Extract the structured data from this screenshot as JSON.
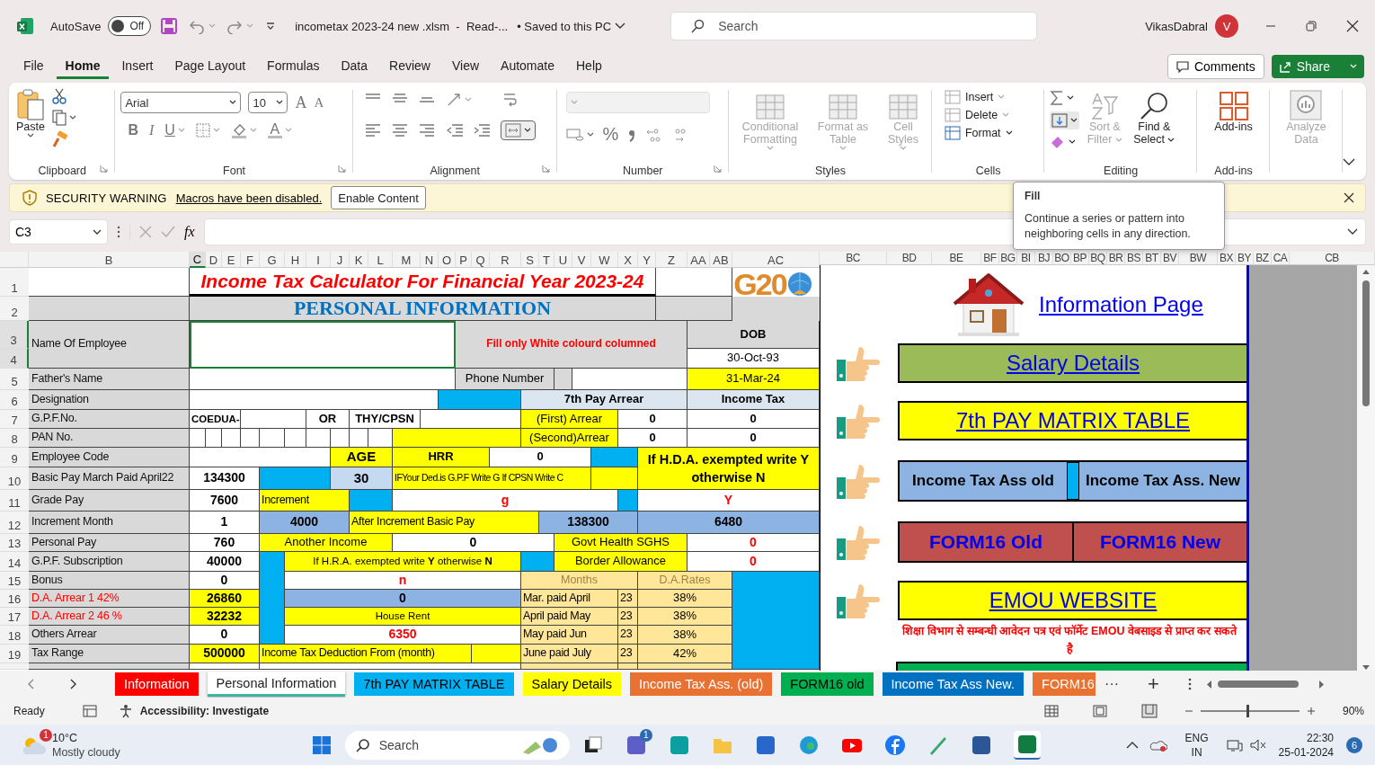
{
  "title_bar": {
    "autosave_label": "AutoSave",
    "autosave_toggle": {
      "label": "Off",
      "on": false
    },
    "file_name": "incometax 2023-24 new .xlsm  -  Read-...",
    "save_status": "• Saved to this PC",
    "search": {
      "placeholder": "Search"
    },
    "user_name": "VikasDabral",
    "avatar_letter": "V"
  },
  "menu_tabs": [
    {
      "label": "File",
      "selected": false
    },
    {
      "label": "Home",
      "selected": true
    },
    {
      "label": "Insert",
      "selected": false
    },
    {
      "label": "Page Layout",
      "selected": false
    },
    {
      "label": "Formulas",
      "selected": false
    },
    {
      "label": "Data",
      "selected": false
    },
    {
      "label": "Review",
      "selected": false
    },
    {
      "label": "View",
      "selected": false
    },
    {
      "label": "Automate",
      "selected": false
    },
    {
      "label": "Help",
      "selected": false
    }
  ],
  "header_buttons": {
    "comments": "Comments",
    "share": "Share"
  },
  "ribbon": {
    "groups": [
      "Clipboard",
      "Font",
      "Alignment",
      "Number",
      "Styles",
      "Cells",
      "Editing",
      "Add-ins"
    ],
    "paste": "Paste",
    "font_name": "Arial",
    "font_size": "10",
    "font_glyphs": [
      "A",
      "A"
    ],
    "format_glyphs": [
      "B",
      "I",
      "U"
    ],
    "font_color_glyph": "A",
    "percent_glyph": "%",
    "style_buttons": [
      {
        "label": "Conditional Formatting",
        "disabled": true
      },
      {
        "label": "Format as Table",
        "disabled": true
      },
      {
        "label": "Cell Styles",
        "disabled": true
      }
    ],
    "cell_buttons": [
      {
        "label": "Insert",
        "disabled": true
      },
      {
        "label": "Delete",
        "disabled": true
      },
      {
        "label": "Format",
        "disabled": false
      }
    ],
    "editing_buttons": [
      {
        "label": "Sort & Filter",
        "disabled": true
      },
      {
        "label": "Find & Select",
        "disabled": false
      }
    ],
    "addins_button": "Add-ins",
    "analyze_button": {
      "label": "Analyze Data",
      "disabled": true
    }
  },
  "security_bar": {
    "title": "SECURITY WARNING",
    "message": "Macros have been disabled.",
    "button": "Enable Content"
  },
  "tooltip": {
    "title": "Fill",
    "text": "Continue a series or pattern into neighboring cells in any direction."
  },
  "formula_bar": {
    "name_box": "C3",
    "function_symbol": "fx"
  },
  "sheet": {
    "column_headers": [
      "B",
      "C",
      "D",
      "E",
      "F",
      "G",
      "H",
      "I",
      "J",
      "K",
      "L",
      "M",
      "N",
      "O",
      "P",
      "Q",
      "R",
      "S",
      "T",
      "U",
      "V",
      "W",
      "X",
      "Y",
      "Z",
      "AA",
      "AB",
      "AC"
    ],
    "right_column_headers": [
      "BC",
      "BD",
      "BE",
      "BF",
      "BG",
      "BI",
      "BJ",
      "BO",
      "BP",
      "BQ",
      "BR",
      "BS",
      "BT",
      "BV",
      "BW",
      "BX",
      "BY",
      "BZ",
      "CA",
      "CB"
    ],
    "logo_text": "G20",
    "rows": [
      {
        "header": "1",
        "cells": [
          "Income Tax Calculator For Financial Year 2023-24"
        ]
      },
      {
        "header": "2",
        "cells": [
          "PERSONAL INFORMATION"
        ]
      },
      {
        "header": "3",
        "cells": [
          "Name Of Employee",
          "Fill only White colourd columned",
          "DOB"
        ]
      },
      {
        "header": "4",
        "cells": [
          "",
          "",
          "30-Oct-93"
        ]
      },
      {
        "header": "5",
        "cells": [
          "Father's Name",
          "Phone Number",
          "31-Mar-24"
        ]
      },
      {
        "header": "6",
        "cells": [
          "Designation",
          "7th Pay Arrear",
          "Income Tax"
        ]
      },
      {
        "header": "7",
        "cells": [
          "G.P.F.No.",
          "COEDUA-",
          "OR",
          "THY/CPSN",
          "(First) Arrear",
          "0",
          "0"
        ]
      },
      {
        "header": "8",
        "cells": [
          "PAN No.",
          "",
          "",
          "",
          "(Second)Arrear",
          "0",
          "0"
        ]
      },
      {
        "header": "9",
        "cells": [
          "Employee Code",
          "AGE",
          "HRR",
          "0",
          "If H.D.A. exempted write Y otherwise N"
        ]
      },
      {
        "header": "10",
        "cells": [
          "Basic Pay March Paid April22",
          "134300",
          "30",
          "IFYour Ded.is G.P.F Write G If CPSN Write C"
        ]
      },
      {
        "header": "11",
        "cells": [
          "Grade Pay",
          "7600",
          "Increment",
          "g",
          "Y"
        ]
      },
      {
        "header": "12",
        "cells": [
          "Increment Month",
          "1",
          "4000",
          "After Increment Basic Pay",
          "138300",
          "6480"
        ]
      },
      {
        "header": "13",
        "cells": [
          "Personal Pay",
          "760",
          "Another Income",
          "0",
          "Govt Health SGHS",
          "",
          "0"
        ]
      },
      {
        "header": "14",
        "cells": [
          "G.P.F. Subscription",
          "40000",
          "",
          "If H.R.A. exempted write **Y** otherwise **N**",
          "",
          "Border Allowance",
          "0"
        ]
      },
      {
        "header": "15",
        "cells": [
          "Bonus",
          "0",
          "n",
          "Months",
          "D.A.Rates"
        ]
      },
      {
        "header": "16",
        "cells": [
          "D.A. Arrear 1 42%",
          "26860",
          "0",
          "Mar. paid April",
          "23",
          "38%"
        ]
      },
      {
        "header": "17",
        "cells": [
          "D.A. Arrear 2 46 %",
          "32232",
          "House Rent",
          "April paid May",
          "23",
          "38%"
        ]
      },
      {
        "header": "18",
        "cells": [
          "Others Arrear",
          "0",
          "6350",
          "May paid Jun",
          "23",
          "38%"
        ]
      },
      {
        "header": "19",
        "cells": [
          "Tax Range",
          "500000",
          "Income Tax Deduction From (month)",
          "June paid July",
          "23",
          "42%"
        ]
      }
    ]
  },
  "right_panel": {
    "info_link": "Information Page",
    "nav_rows": [
      {
        "kind": "link",
        "labels": [
          "Salary Details"
        ],
        "color": "#9bbb59"
      },
      {
        "kind": "link",
        "labels": [
          "7th PAY MATRIX TABLE"
        ],
        "color": "#ffff00"
      },
      {
        "kind": "tax-pair",
        "labels": [
          "Income Tax Ass old",
          "Income Tax Ass. New"
        ],
        "color": "#8db3e2"
      },
      {
        "kind": "form-pair",
        "labels": [
          "FORM16 Old",
          "FORM16 New"
        ],
        "color": "#c0504d"
      },
      {
        "kind": "link",
        "labels": [
          "EMOU WEBSITE"
        ],
        "color": "#ffff00"
      }
    ],
    "note": "शिक्षा विभाग से सम्बन्धी आवेदन पत्र एवं फॉर्मेट EMOU वेबसाइड से प्राप्त कर सकते है"
  },
  "sheet_tabs": [
    {
      "label": "Information",
      "selected": false,
      "color": "#ff0000"
    },
    {
      "label": "Personal Information",
      "selected": true,
      "color": "#3cb6a0"
    },
    {
      "label": "7th PAY MATRIX TABLE",
      "selected": false,
      "color": "#00b0f0"
    },
    {
      "label": "Salary Details",
      "selected": false,
      "color": "#ffff00"
    },
    {
      "label": "Income Tax Ass. (old)",
      "selected": false,
      "color": "#e97132"
    },
    {
      "label": "FORM16 old",
      "selected": false,
      "color": "#00b050"
    },
    {
      "label": "Income Tax Ass New.",
      "selected": false,
      "color": "#0070c0"
    },
    {
      "label": "FORM16",
      "selected": false,
      "color": "#e97132"
    }
  ],
  "sheet_nav": {
    "more": "···",
    "add": "+"
  },
  "status_bar": {
    "ready": "Ready",
    "accessibility": "Accessibility: Investigate",
    "zoom": "90%",
    "zoom_slider": {
      "level": 0.47
    }
  },
  "taskbar": {
    "temperature": "10°C",
    "weather": "Mostly cloudy",
    "weather_badge": "1",
    "search_placeholder": "Search",
    "chat_badge": "1",
    "language": "ENG",
    "region": "IN",
    "time": "22:30",
    "date": "25-01-2024",
    "notifications": "6"
  }
}
